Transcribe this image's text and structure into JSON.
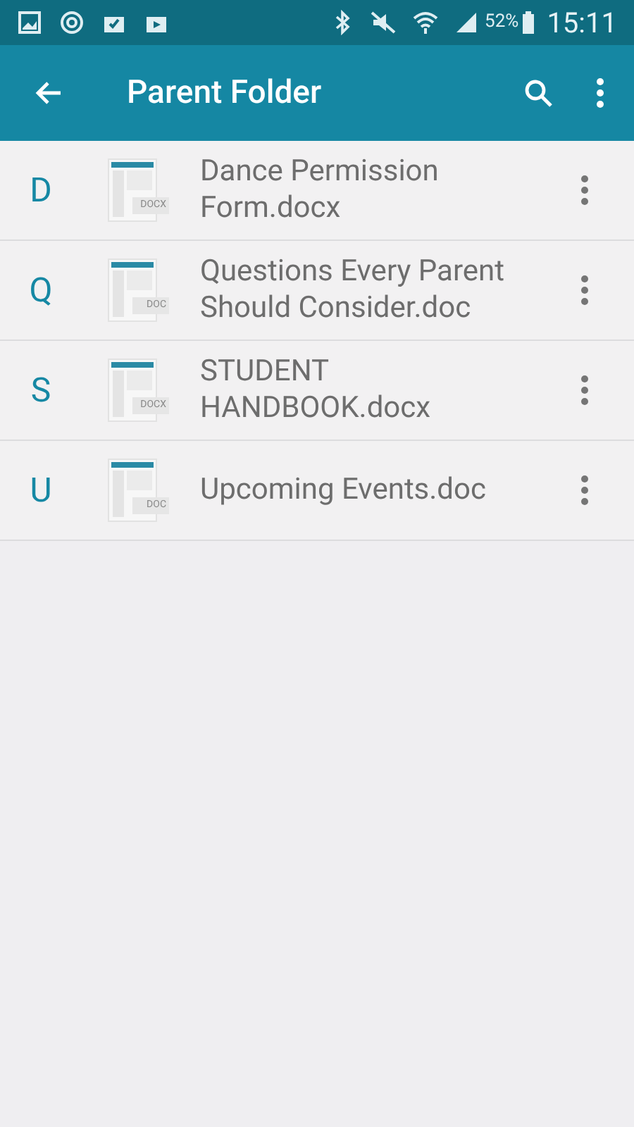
{
  "status_bar": {
    "battery": "52%",
    "time": "15:11"
  },
  "app_bar": {
    "title": "Parent Folder"
  },
  "files": [
    {
      "letter": "D",
      "name": "Dance Permission Form.docx",
      "type": "DOCX"
    },
    {
      "letter": "Q",
      "name": "Questions Every Parent Should Consider.doc",
      "type": "DOC"
    },
    {
      "letter": "S",
      "name": "STUDENT HANDBOOK.docx",
      "type": "DOCX"
    },
    {
      "letter": "U",
      "name": "Upcoming Events.doc",
      "type": "DOC"
    }
  ]
}
